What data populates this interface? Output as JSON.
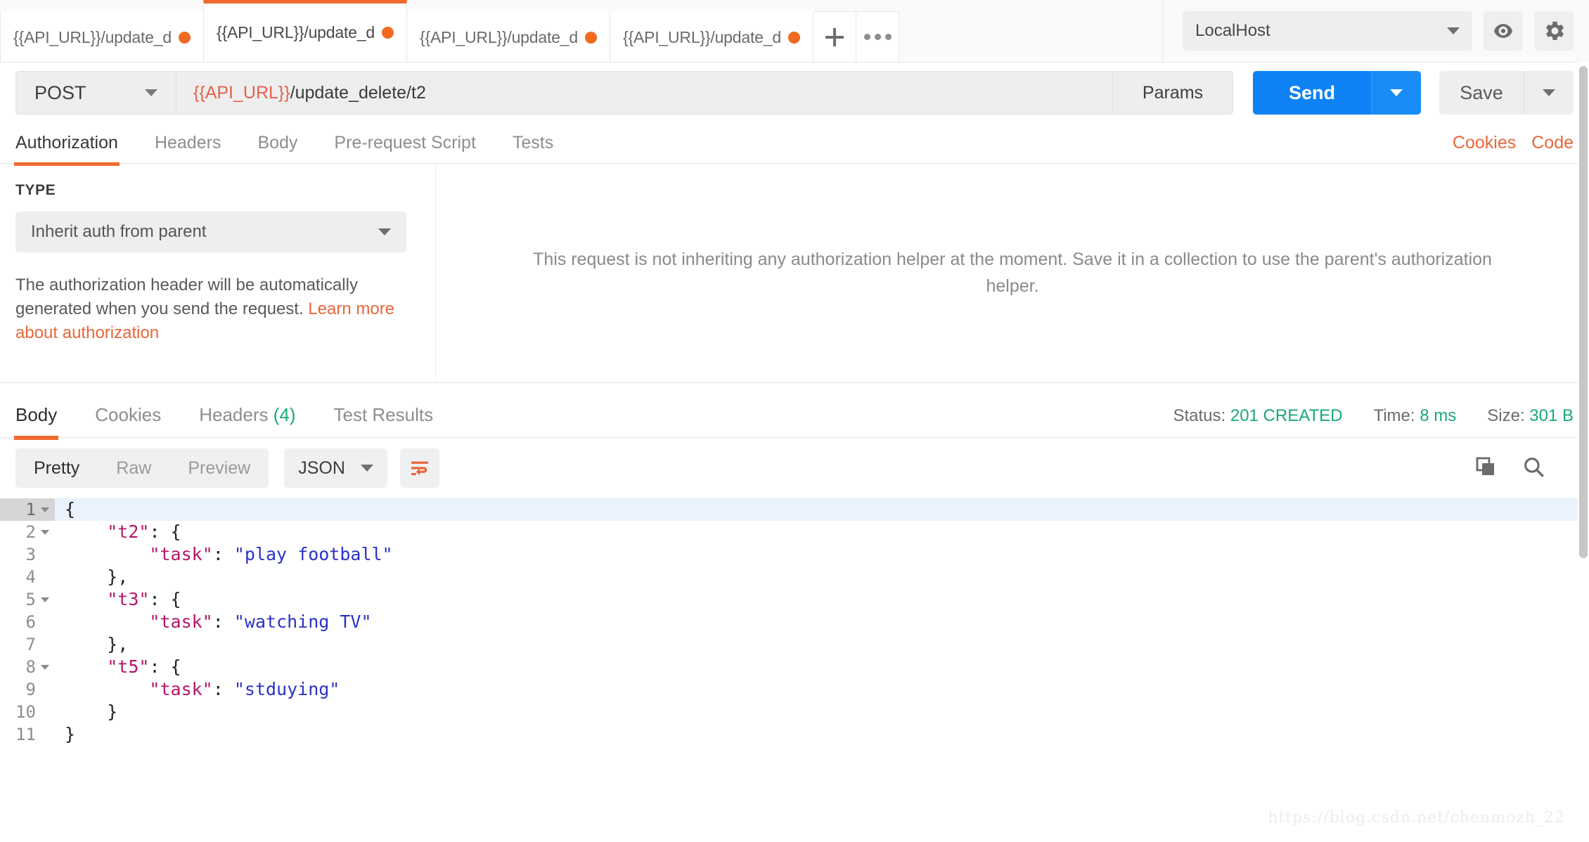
{
  "tabbar": {
    "tabs": [
      {
        "label": "{{API_URL}}/update_d",
        "unsaved": true,
        "active": false
      },
      {
        "label": "{{API_URL}}/update_d",
        "unsaved": true,
        "active": true
      },
      {
        "label": "{{API_URL}}/update_d",
        "unsaved": true,
        "active": false
      },
      {
        "label": "{{API_URL}}/update_d",
        "unsaved": true,
        "active": false
      }
    ],
    "new_tab_icon": "plus-icon",
    "more_icon": "ellipsis-icon",
    "environment": "LocalHost",
    "eye_icon": "eye-icon",
    "settings_icon": "gear-icon"
  },
  "urlbar": {
    "method": "POST",
    "url_variable": "{{API_URL}}",
    "url_path": "/update_delete/t2",
    "url_full": "{{API_URL}}/update_delete/t2",
    "params_label": "Params",
    "send_label": "Send",
    "save_label": "Save"
  },
  "request_tabs": {
    "items": [
      {
        "label": "Authorization",
        "active": true
      },
      {
        "label": "Headers",
        "active": false
      },
      {
        "label": "Body",
        "active": false
      },
      {
        "label": "Pre-request Script",
        "active": false
      },
      {
        "label": "Tests",
        "active": false
      }
    ],
    "cookies_label": "Cookies",
    "code_label": "Code"
  },
  "auth": {
    "type_label": "TYPE",
    "type_value": "Inherit auth from parent",
    "description_text": "The authorization header will be automatically generated when you send the request. ",
    "description_link": "Learn more about authorization",
    "inherit_message": "This request is not inheriting any authorization helper at the moment. Save it in a collection to use the parent's authorization helper."
  },
  "response_tabs": {
    "items": [
      {
        "label": "Body",
        "active": true,
        "count": ""
      },
      {
        "label": "Cookies",
        "active": false,
        "count": ""
      },
      {
        "label": "Headers",
        "active": false,
        "count": "(4)"
      },
      {
        "label": "Test Results",
        "active": false,
        "count": ""
      }
    ],
    "status_label": "Status:",
    "status_value": "201 CREATED",
    "time_label": "Time:",
    "time_value": "8 ms",
    "size_label": "Size:",
    "size_value": "301 B"
  },
  "response_toolbar": {
    "view_modes": [
      {
        "label": "Pretty",
        "active": true
      },
      {
        "label": "Raw",
        "active": false
      },
      {
        "label": "Preview",
        "active": false
      }
    ],
    "format": "JSON",
    "wrap_icon": "word-wrap-icon",
    "copy_icon": "copy-icon",
    "search_icon": "search-icon"
  },
  "response_body": {
    "lines": [
      {
        "num": "1",
        "foldable": true,
        "highlight": true,
        "indent": 0,
        "tokens": [
          {
            "t": "p",
            "v": "{"
          }
        ]
      },
      {
        "num": "2",
        "foldable": true,
        "highlight": false,
        "indent": 1,
        "tokens": [
          {
            "t": "k",
            "v": "\"t2\""
          },
          {
            "t": "p",
            "v": ": {"
          }
        ]
      },
      {
        "num": "3",
        "foldable": false,
        "highlight": false,
        "indent": 2,
        "tokens": [
          {
            "t": "k",
            "v": "\"task\""
          },
          {
            "t": "p",
            "v": ": "
          },
          {
            "t": "s",
            "v": "\"play football\""
          }
        ]
      },
      {
        "num": "4",
        "foldable": false,
        "highlight": false,
        "indent": 1,
        "tokens": [
          {
            "t": "p",
            "v": "},"
          }
        ]
      },
      {
        "num": "5",
        "foldable": true,
        "highlight": false,
        "indent": 1,
        "tokens": [
          {
            "t": "k",
            "v": "\"t3\""
          },
          {
            "t": "p",
            "v": ": {"
          }
        ]
      },
      {
        "num": "6",
        "foldable": false,
        "highlight": false,
        "indent": 2,
        "tokens": [
          {
            "t": "k",
            "v": "\"task\""
          },
          {
            "t": "p",
            "v": ": "
          },
          {
            "t": "s",
            "v": "\"watching TV\""
          }
        ]
      },
      {
        "num": "7",
        "foldable": false,
        "highlight": false,
        "indent": 1,
        "tokens": [
          {
            "t": "p",
            "v": "},"
          }
        ]
      },
      {
        "num": "8",
        "foldable": true,
        "highlight": false,
        "indent": 1,
        "tokens": [
          {
            "t": "k",
            "v": "\"t5\""
          },
          {
            "t": "p",
            "v": ": {"
          }
        ]
      },
      {
        "num": "9",
        "foldable": false,
        "highlight": false,
        "indent": 2,
        "tokens": [
          {
            "t": "k",
            "v": "\"task\""
          },
          {
            "t": "p",
            "v": ": "
          },
          {
            "t": "s",
            "v": "\"stduying\""
          }
        ]
      },
      {
        "num": "10",
        "foldable": false,
        "highlight": false,
        "indent": 1,
        "tokens": [
          {
            "t": "p",
            "v": "}"
          }
        ]
      },
      {
        "num": "11",
        "foldable": false,
        "highlight": false,
        "indent": 0,
        "tokens": [
          {
            "t": "p",
            "v": "}"
          }
        ]
      }
    ]
  },
  "watermark": "https://blog.csdn.net/chenmozh_22",
  "colors": {
    "accent_orange": "#ef6a2e",
    "send_blue": "#0f83f5",
    "status_green": "#19a974",
    "json_key": "#b4156b",
    "json_string": "#2b32c7"
  }
}
